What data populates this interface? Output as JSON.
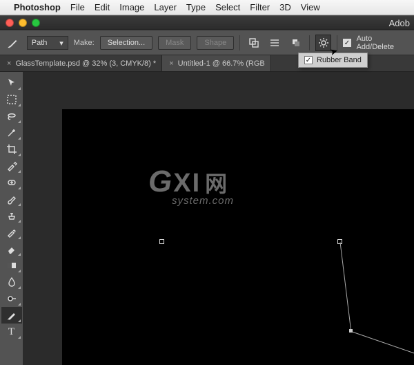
{
  "mac_menu": {
    "items": [
      "Photoshop",
      "File",
      "Edit",
      "Image",
      "Layer",
      "Type",
      "Select",
      "Filter",
      "3D",
      "View"
    ]
  },
  "window": {
    "title_fragment": "Adob"
  },
  "options": {
    "mode": "Path",
    "make_label": "Make:",
    "selection_btn": "Selection...",
    "mask_btn": "Mask",
    "shape_btn": "Shape",
    "auto_add_delete": "Auto Add/Delete",
    "rubber_band": "Rubber Band"
  },
  "tabs": [
    {
      "label": "GlassTemplate.psd @ 32% (3, CMYK/8) *",
      "active": false
    },
    {
      "label": "Untitled-1 @ 66.7% (RGB",
      "active": true
    }
  ],
  "tools": [
    {
      "name": "move-tool"
    },
    {
      "name": "marquee-tool"
    },
    {
      "name": "lasso-tool"
    },
    {
      "name": "magic-wand-tool"
    },
    {
      "name": "crop-tool"
    },
    {
      "name": "eyedropper-tool"
    },
    {
      "name": "healing-brush-tool"
    },
    {
      "name": "brush-tool"
    },
    {
      "name": "clone-stamp-tool"
    },
    {
      "name": "history-brush-tool"
    },
    {
      "name": "eraser-tool"
    },
    {
      "name": "gradient-tool"
    },
    {
      "name": "blur-tool"
    },
    {
      "name": "dodge-tool"
    },
    {
      "name": "pen-tool",
      "active": true
    },
    {
      "name": "type-tool"
    }
  ],
  "watermark": {
    "g": "G",
    "xi": "XI",
    "cn": "网",
    "sub": "system.com"
  }
}
